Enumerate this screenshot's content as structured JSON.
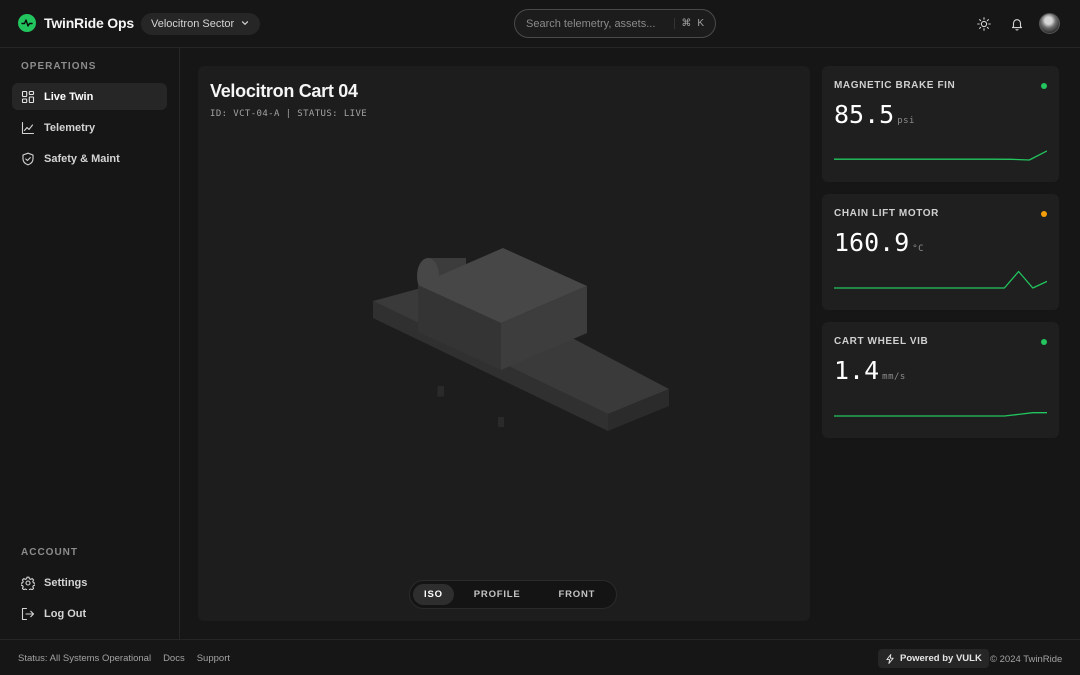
{
  "header": {
    "brand": "TwinRide Ops",
    "sector": "Velocitron Sector",
    "search_placeholder": "Search telemetry, assets...",
    "shortcut_symbol": "⌘",
    "shortcut_key": "K"
  },
  "sidebar": {
    "operations_label": "OPERATIONS",
    "account_label": "ACCOUNT",
    "items": [
      {
        "label": "Live Twin",
        "icon": "grid-icon",
        "active": true
      },
      {
        "label": "Telemetry",
        "icon": "line-chart-icon"
      },
      {
        "label": "Safety & Maint",
        "icon": "shield-icon"
      }
    ],
    "account_items": [
      {
        "label": "Settings",
        "icon": "gear-icon"
      },
      {
        "label": "Log Out",
        "icon": "logout-icon"
      }
    ]
  },
  "viewer": {
    "title": "Velocitron Cart 04",
    "meta": "ID: VCT-04-A | STATUS: LIVE",
    "views": [
      "ISO",
      "PROFILE",
      "FRONT"
    ],
    "active_view": "ISO"
  },
  "metrics": [
    {
      "title": "MAGNETIC BRAKE FIN",
      "value": "85.5",
      "unit": "psi",
      "status_color": "#22c55e",
      "trend": [
        0.05,
        0.05,
        0.05,
        0.05,
        0.05,
        0.05,
        0.05,
        0.05,
        0.05,
        0.05,
        0.04,
        0.0,
        0.55
      ]
    },
    {
      "title": "CHAIN LIFT MOTOR",
      "value": "160.9",
      "unit": "°C",
      "status_color": "#f59e0b",
      "trend": [
        0.0,
        0.0,
        0.0,
        0.0,
        0.0,
        0.0,
        0.0,
        0.0,
        0.0,
        0.0,
        0.0,
        0.0,
        0.0,
        1.0,
        0.0,
        0.4
      ]
    },
    {
      "title": "CART WHEEL VIB",
      "value": "1.4",
      "unit": "mm/s",
      "status_color": "#22c55e",
      "trend": [
        0.0,
        0.0,
        0.0,
        0.0,
        0.0,
        0.0,
        0.0,
        0.0,
        0.0,
        0.0,
        0.0,
        0.0,
        0.0,
        0.1,
        0.2,
        0.2
      ]
    }
  ],
  "footer": {
    "status": "Status: All Systems Operational",
    "docs": "Docs",
    "support": "Support",
    "powered": "Powered by VULK",
    "copyright": "© 2024 TwinRide"
  },
  "colors": {
    "accent": "#22c55e",
    "warning": "#f59e0b",
    "background": "#161616",
    "panel": "#1d1d1d"
  }
}
